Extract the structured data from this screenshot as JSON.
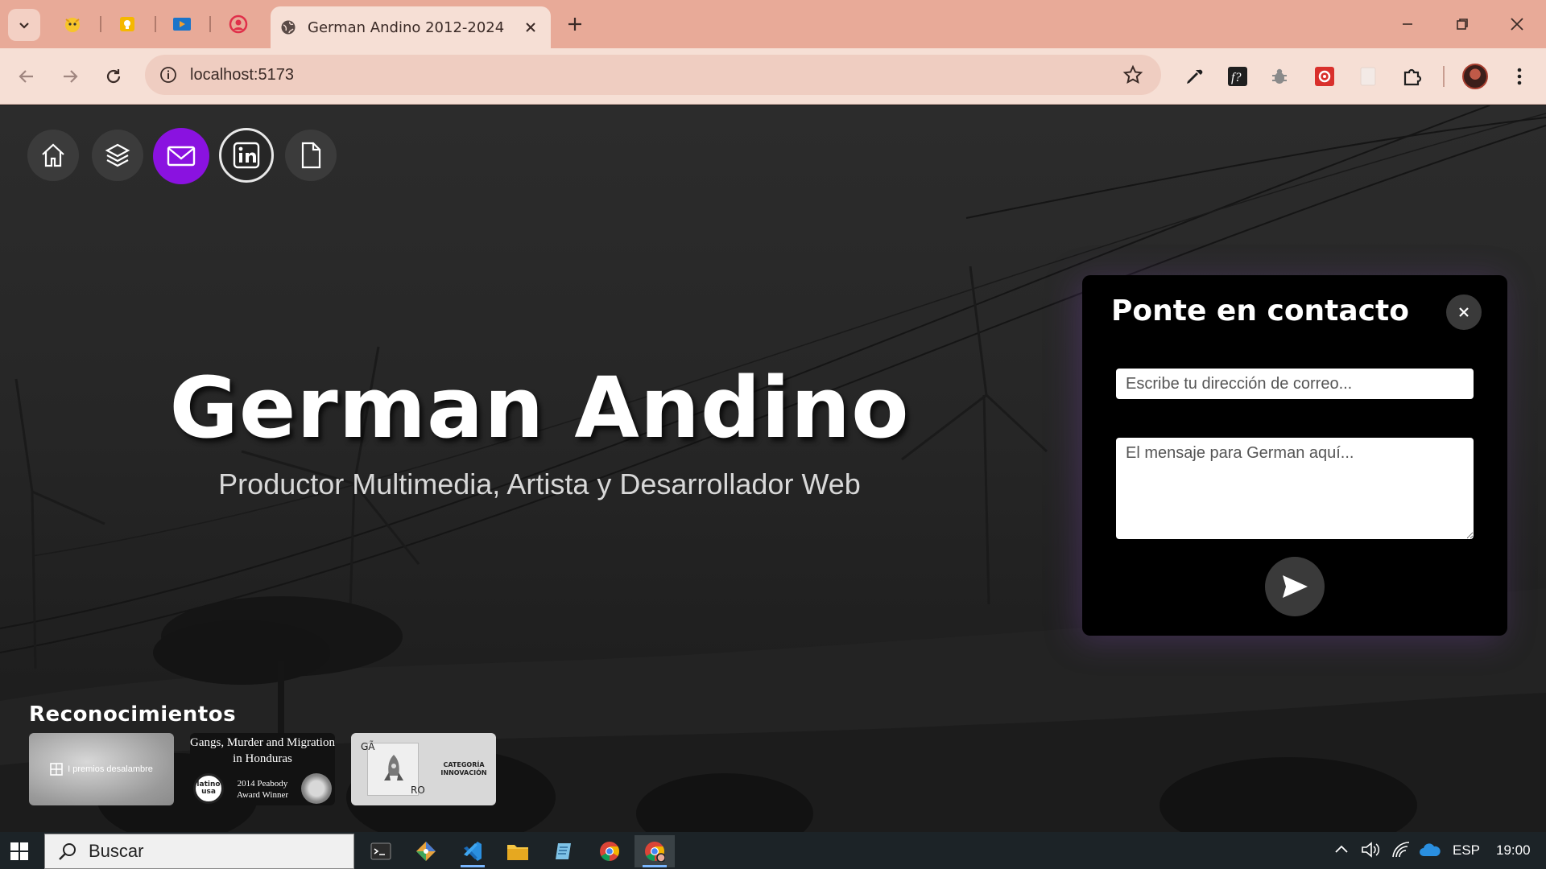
{
  "browser": {
    "tab_title": "German Andino 2012-2024",
    "url": "localhost:5173",
    "pinned_tabs": [
      "cat-face-icon",
      "yellow-note-icon",
      "video-icon",
      "record-icon"
    ],
    "extensions": [
      "eyedropper-icon",
      "font-f-icon",
      "bug-icon",
      "red-puzzle-icon",
      "blank-extension-icon",
      "extensions-puzzle-icon"
    ]
  },
  "nav": {
    "icons": [
      "home-icon",
      "layers-icon",
      "mail-icon",
      "linkedin-icon",
      "document-icon"
    ],
    "active": "mail-icon",
    "accent_color": "#8a12e0"
  },
  "hero": {
    "title": "German Andino",
    "subtitle": "Productor Multimedia, Artista y Desarrollador Web"
  },
  "awards": {
    "heading": "Reconocimientos",
    "items": [
      {
        "label": "I premios desalambre"
      },
      {
        "title": "Gangs, Murder and Migration in Honduras",
        "seal": "latino usa",
        "caption": "2014 Peabody Award Winner"
      },
      {
        "top_letters": "GÃ",
        "bottom_letters": "RO",
        "category": "CATEGORÍA INNOVACIÓN"
      }
    ]
  },
  "contact": {
    "title": "Ponte en contacto",
    "email_placeholder": "Escribe tu dirección de correo...",
    "message_placeholder": "El mensaje para German aquí...",
    "close_label": "✕"
  },
  "taskbar": {
    "search_placeholder": "Buscar",
    "language": "ESP",
    "time": "19:00"
  }
}
